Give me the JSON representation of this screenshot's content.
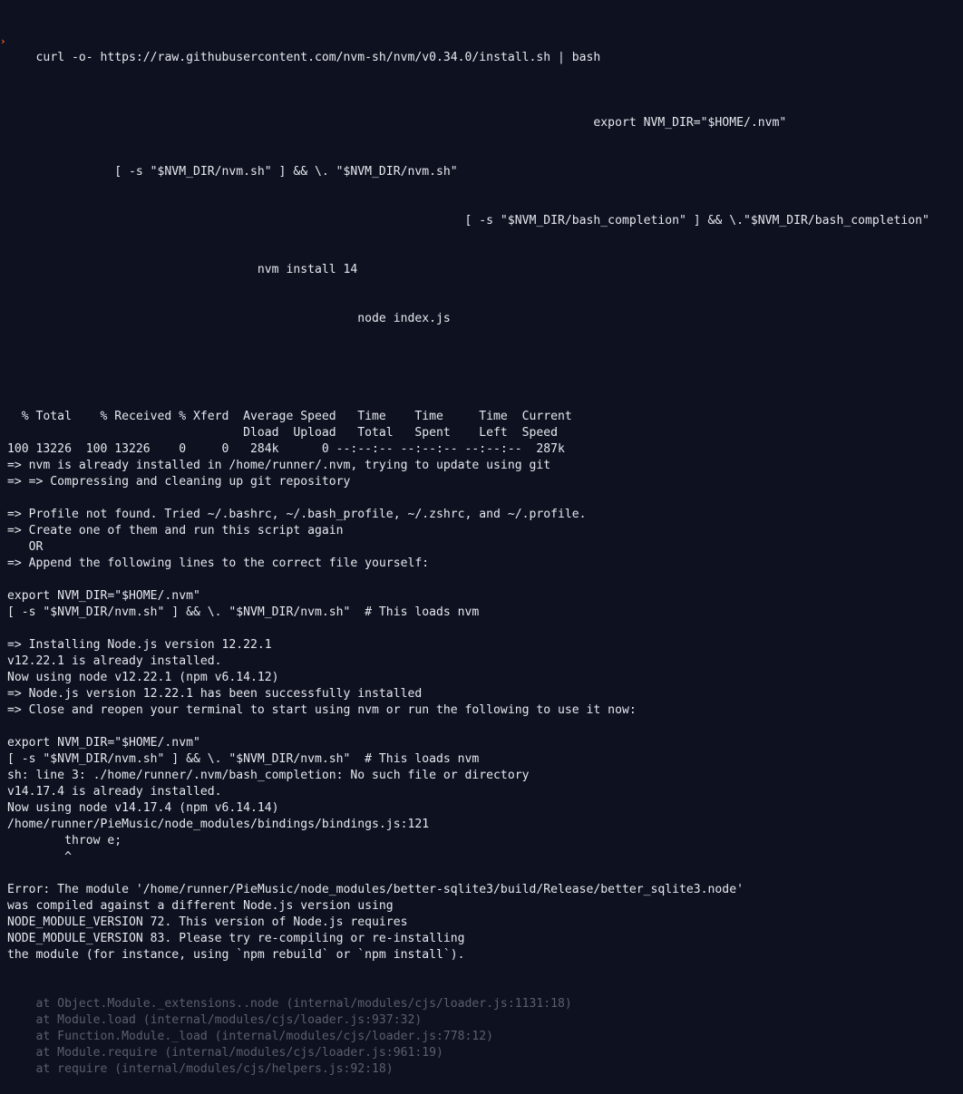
{
  "terminal": {
    "prompt_symbol": "›",
    "command": "curl -o- https://raw.githubusercontent.com/nvm-sh/nvm/v0.34.0/install.sh | bash",
    "command_continuation": [
      "                                                                                  export NVM_DIR=\"$HOME/.nvm\"",
      "               [ -s \"$NVM_DIR/nvm.sh\" ] && \\. \"$NVM_DIR/nvm.sh\"",
      "                                                                [ -s \"$NVM_DIR/bash_completion\" ] && \\.\"$NVM_DIR/bash_completion\"",
      "                                   nvm install 14",
      "                                                 node index.js"
    ],
    "output": [
      "",
      "  % Total    % Received % Xferd  Average Speed   Time    Time     Time  Current",
      "                                 Dload  Upload   Total   Spent    Left  Speed",
      "100 13226  100 13226    0     0   284k      0 --:--:-- --:--:-- --:--:--  287k",
      "=> nvm is already installed in /home/runner/.nvm, trying to update using git",
      "=> => Compressing and cleaning up git repository",
      "",
      "=> Profile not found. Tried ~/.bashrc, ~/.bash_profile, ~/.zshrc, and ~/.profile.",
      "=> Create one of them and run this script again",
      "   OR",
      "=> Append the following lines to the correct file yourself:",
      "",
      "export NVM_DIR=\"$HOME/.nvm\"",
      "[ -s \"$NVM_DIR/nvm.sh\" ] && \\. \"$NVM_DIR/nvm.sh\"  # This loads nvm",
      "",
      "=> Installing Node.js version 12.22.1",
      "v12.22.1 is already installed.",
      "Now using node v12.22.1 (npm v6.14.12)",
      "=> Node.js version 12.22.1 has been successfully installed",
      "=> Close and reopen your terminal to start using nvm or run the following to use it now:",
      "",
      "export NVM_DIR=\"$HOME/.nvm\"",
      "[ -s \"$NVM_DIR/nvm.sh\" ] && \\. \"$NVM_DIR/nvm.sh\"  # This loads nvm",
      "sh: line 3: ./home/runner/.nvm/bash_completion: No such file or directory",
      "v14.17.4 is already installed.",
      "Now using node v14.17.4 (npm v6.14.14)",
      "/home/runner/PieMusic/node_modules/bindings/bindings.js:121",
      "        throw e;",
      "        ^",
      "",
      "Error: The module '/home/runner/PieMusic/node_modules/better-sqlite3/build/Release/better_sqlite3.node'",
      "was compiled against a different Node.js version using",
      "NODE_MODULE_VERSION 72. This version of Node.js requires",
      "NODE_MODULE_VERSION 83. Please try re-compiling or re-installing",
      "the module (for instance, using `npm rebuild` or `npm install`)."
    ],
    "stack_trace": [
      "    at Object.Module._extensions..node (internal/modules/cjs/loader.js:1131:18)",
      "    at Module.load (internal/modules/cjs/loader.js:937:32)",
      "    at Function.Module._load (internal/modules/cjs/loader.js:778:12)",
      "    at Module.require (internal/modules/cjs/loader.js:961:19)",
      "    at require (internal/modules/cjs/helpers.js:92:18)"
    ]
  },
  "colors": {
    "background": "#0e1120",
    "text": "#e6e8ee",
    "prompt": "#f26b21",
    "stack_trace": "#5b606c"
  }
}
